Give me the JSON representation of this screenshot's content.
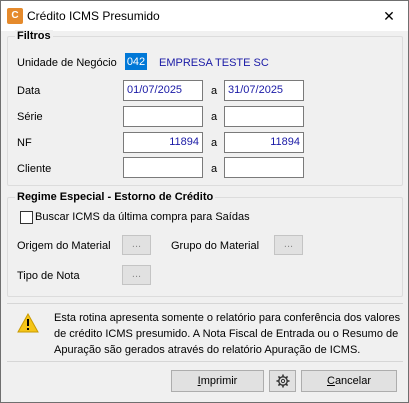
{
  "window": {
    "title": "Crédito ICMS Presumido",
    "app_icon": "app-icon",
    "close_icon": "✕"
  },
  "filters": {
    "legend": "Filtros",
    "unit_label": "Unidade de Negócio",
    "unit_code": "042",
    "unit_name": "EMPRESA TESTE SC",
    "date_label": "Data",
    "date_from": "01/07/2025",
    "date_to": "31/07/2025",
    "range_sep": "a",
    "serie_label": "Série",
    "serie_from": "",
    "serie_to": "",
    "nf_label": "NF",
    "nf_from": "11894",
    "nf_to": "11894",
    "client_label": "Cliente",
    "client_from": "",
    "client_to": ""
  },
  "regime": {
    "legend": "Regime Especial - Estorno de Crédito",
    "checkbox_label": "Buscar ICMS da última compra para Saídas",
    "checkbox_checked": false,
    "origem_label": "Origem do Material",
    "grupo_label": "Grupo do Material",
    "tipo_label": "Tipo de Nota",
    "ellipsis": "..."
  },
  "notice": {
    "icon": "warning-icon",
    "text": "Esta rotina apresenta somente o relatório para conferência dos valores de crédito ICMS presumido. A Nota Fiscal de Entrada ou o Resumo de Apuração são gerados através do relatório Apuração de ICMS."
  },
  "buttons": {
    "print_mnemonic": "I",
    "print_rest": "mprimir",
    "settings_icon": "gear-icon",
    "cancel_mnemonic": "C",
    "cancel_rest": "ancelar"
  },
  "colors": {
    "accent": "#0078d7",
    "value_text": "#1a1aa6",
    "warning": "#f5c518"
  }
}
